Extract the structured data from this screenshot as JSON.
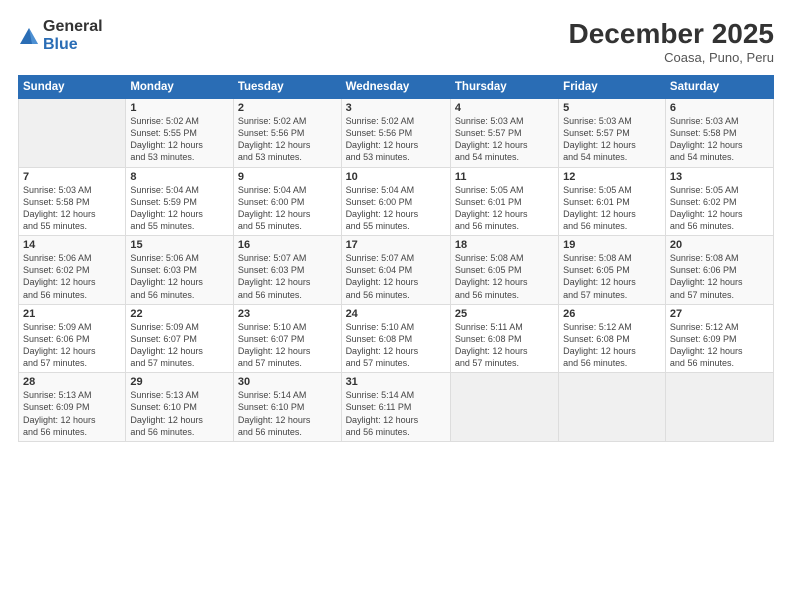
{
  "logo": {
    "general": "General",
    "blue": "Blue"
  },
  "header": {
    "month": "December 2025",
    "location": "Coasa, Puno, Peru"
  },
  "days_of_week": [
    "Sunday",
    "Monday",
    "Tuesday",
    "Wednesday",
    "Thursday",
    "Friday",
    "Saturday"
  ],
  "weeks": [
    [
      {
        "day": "",
        "info": ""
      },
      {
        "day": "1",
        "info": "Sunrise: 5:02 AM\nSunset: 5:55 PM\nDaylight: 12 hours\nand 53 minutes."
      },
      {
        "day": "2",
        "info": "Sunrise: 5:02 AM\nSunset: 5:56 PM\nDaylight: 12 hours\nand 53 minutes."
      },
      {
        "day": "3",
        "info": "Sunrise: 5:02 AM\nSunset: 5:56 PM\nDaylight: 12 hours\nand 53 minutes."
      },
      {
        "day": "4",
        "info": "Sunrise: 5:03 AM\nSunset: 5:57 PM\nDaylight: 12 hours\nand 54 minutes."
      },
      {
        "day": "5",
        "info": "Sunrise: 5:03 AM\nSunset: 5:57 PM\nDaylight: 12 hours\nand 54 minutes."
      },
      {
        "day": "6",
        "info": "Sunrise: 5:03 AM\nSunset: 5:58 PM\nDaylight: 12 hours\nand 54 minutes."
      }
    ],
    [
      {
        "day": "7",
        "info": "Sunrise: 5:03 AM\nSunset: 5:58 PM\nDaylight: 12 hours\nand 55 minutes."
      },
      {
        "day": "8",
        "info": "Sunrise: 5:04 AM\nSunset: 5:59 PM\nDaylight: 12 hours\nand 55 minutes."
      },
      {
        "day": "9",
        "info": "Sunrise: 5:04 AM\nSunset: 6:00 PM\nDaylight: 12 hours\nand 55 minutes."
      },
      {
        "day": "10",
        "info": "Sunrise: 5:04 AM\nSunset: 6:00 PM\nDaylight: 12 hours\nand 55 minutes."
      },
      {
        "day": "11",
        "info": "Sunrise: 5:05 AM\nSunset: 6:01 PM\nDaylight: 12 hours\nand 56 minutes."
      },
      {
        "day": "12",
        "info": "Sunrise: 5:05 AM\nSunset: 6:01 PM\nDaylight: 12 hours\nand 56 minutes."
      },
      {
        "day": "13",
        "info": "Sunrise: 5:05 AM\nSunset: 6:02 PM\nDaylight: 12 hours\nand 56 minutes."
      }
    ],
    [
      {
        "day": "14",
        "info": "Sunrise: 5:06 AM\nSunset: 6:02 PM\nDaylight: 12 hours\nand 56 minutes."
      },
      {
        "day": "15",
        "info": "Sunrise: 5:06 AM\nSunset: 6:03 PM\nDaylight: 12 hours\nand 56 minutes."
      },
      {
        "day": "16",
        "info": "Sunrise: 5:07 AM\nSunset: 6:03 PM\nDaylight: 12 hours\nand 56 minutes."
      },
      {
        "day": "17",
        "info": "Sunrise: 5:07 AM\nSunset: 6:04 PM\nDaylight: 12 hours\nand 56 minutes."
      },
      {
        "day": "18",
        "info": "Sunrise: 5:08 AM\nSunset: 6:05 PM\nDaylight: 12 hours\nand 56 minutes."
      },
      {
        "day": "19",
        "info": "Sunrise: 5:08 AM\nSunset: 6:05 PM\nDaylight: 12 hours\nand 57 minutes."
      },
      {
        "day": "20",
        "info": "Sunrise: 5:08 AM\nSunset: 6:06 PM\nDaylight: 12 hours\nand 57 minutes."
      }
    ],
    [
      {
        "day": "21",
        "info": "Sunrise: 5:09 AM\nSunset: 6:06 PM\nDaylight: 12 hours\nand 57 minutes."
      },
      {
        "day": "22",
        "info": "Sunrise: 5:09 AM\nSunset: 6:07 PM\nDaylight: 12 hours\nand 57 minutes."
      },
      {
        "day": "23",
        "info": "Sunrise: 5:10 AM\nSunset: 6:07 PM\nDaylight: 12 hours\nand 57 minutes."
      },
      {
        "day": "24",
        "info": "Sunrise: 5:10 AM\nSunset: 6:08 PM\nDaylight: 12 hours\nand 57 minutes."
      },
      {
        "day": "25",
        "info": "Sunrise: 5:11 AM\nSunset: 6:08 PM\nDaylight: 12 hours\nand 57 minutes."
      },
      {
        "day": "26",
        "info": "Sunrise: 5:12 AM\nSunset: 6:08 PM\nDaylight: 12 hours\nand 56 minutes."
      },
      {
        "day": "27",
        "info": "Sunrise: 5:12 AM\nSunset: 6:09 PM\nDaylight: 12 hours\nand 56 minutes."
      }
    ],
    [
      {
        "day": "28",
        "info": "Sunrise: 5:13 AM\nSunset: 6:09 PM\nDaylight: 12 hours\nand 56 minutes."
      },
      {
        "day": "29",
        "info": "Sunrise: 5:13 AM\nSunset: 6:10 PM\nDaylight: 12 hours\nand 56 minutes."
      },
      {
        "day": "30",
        "info": "Sunrise: 5:14 AM\nSunset: 6:10 PM\nDaylight: 12 hours\nand 56 minutes."
      },
      {
        "day": "31",
        "info": "Sunrise: 5:14 AM\nSunset: 6:11 PM\nDaylight: 12 hours\nand 56 minutes."
      },
      {
        "day": "",
        "info": ""
      },
      {
        "day": "",
        "info": ""
      },
      {
        "day": "",
        "info": ""
      }
    ]
  ]
}
